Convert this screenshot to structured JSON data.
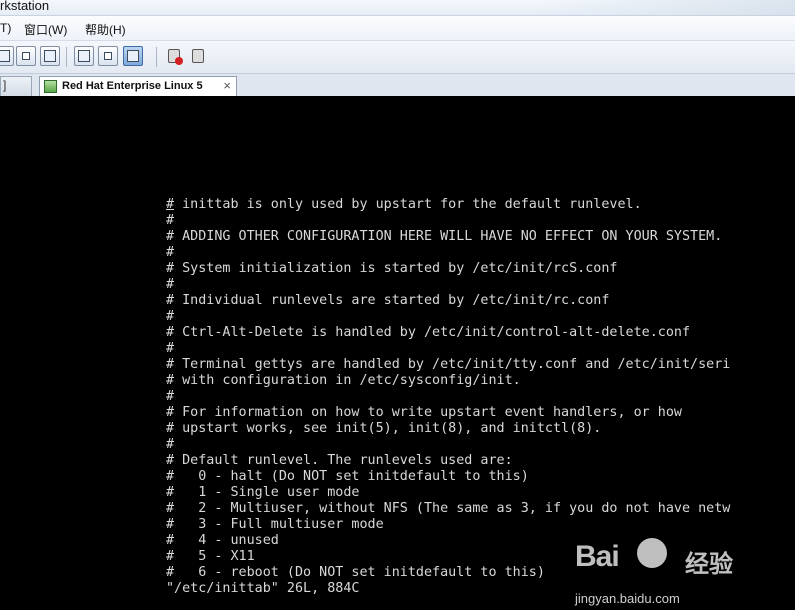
{
  "window": {
    "title": "rkstation"
  },
  "menu": {
    "items": [
      "T)",
      "窗口(W)",
      "帮助(H)"
    ]
  },
  "tabs": {
    "active_label": "Red Hat Enterprise Linux 5",
    "close_glyph": "×",
    "left_glyph": "]"
  },
  "console": {
    "lines": [
      "# inittab is only used by upstart for the default runlevel.",
      "#",
      "# ADDING OTHER CONFIGURATION HERE WILL HAVE NO EFFECT ON YOUR SYSTEM.",
      "#",
      "# System initialization is started by /etc/init/rcS.conf",
      "#",
      "# Individual runlevels are started by /etc/init/rc.conf",
      "#",
      "# Ctrl-Alt-Delete is handled by /etc/init/control-alt-delete.conf",
      "#",
      "# Terminal gettys are handled by /etc/init/tty.conf and /etc/init/seri",
      "# with configuration in /etc/sysconfig/init.",
      "#",
      "# For information on how to write upstart event handlers, or how",
      "# upstart works, see init(5), init(8), and initctl(8).",
      "#",
      "# Default runlevel. The runlevels used are:",
      "#   0 - halt (Do NOT set initdefault to this)",
      "#   1 - Single user mode",
      "#   2 - Multiuser, without NFS (The same as 3, if you do not have netw",
      "#   3 - Full multiuser mode",
      "#   4 - unused",
      "#   5 - X11",
      "#   6 - reboot (Do NOT set initdefault to this)",
      "\"/etc/inittab\" 26L, 884C"
    ]
  },
  "watermark": {
    "brand": "Bai",
    "brand2": "经验",
    "url": "jingyan.baidu.com"
  }
}
